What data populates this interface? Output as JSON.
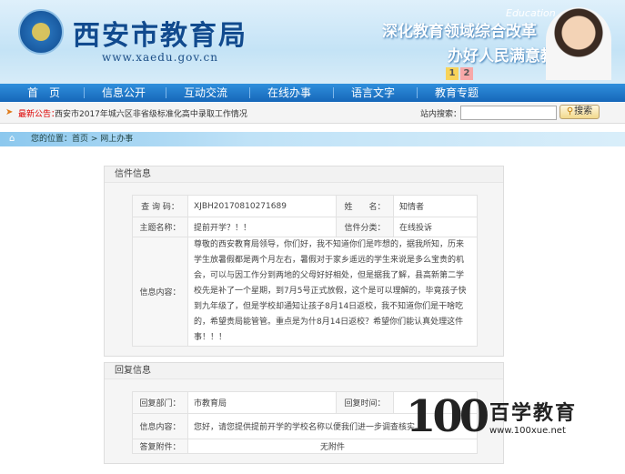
{
  "header": {
    "site_title": "西安市教育局",
    "site_url": "www.xaedu.gov.cn",
    "slogan_line1": "深化教育领域综合改革",
    "slogan_line2": "办好人民满意教育",
    "banner_word": "Education"
  },
  "nav": {
    "items": [
      "首　页",
      "信息公开",
      "互动交流",
      "在线办事",
      "语言文字",
      "教育专题"
    ]
  },
  "newsbar": {
    "label": "最新公告：",
    "text": "西安市2017年城六区非省级标准化高中录取工作情况",
    "search_label": "站内搜索：",
    "search_value": "",
    "search_button": "搜索"
  },
  "breadcrumb": {
    "text": "您的位置：首页 > 网上办事"
  },
  "letter": {
    "section_title": "信件信息",
    "query_label": "查 询 码：",
    "query_value": "XJBH20170810271689",
    "name_label": "姓　　名：",
    "name_value": "知情者",
    "subject_label": "主题名称：",
    "subject_value": "提前开学？！！",
    "category_label": "信件分类：",
    "category_value": "在线投诉",
    "content_label": "信息内容：",
    "content_value": "尊敬的西安教育局领导，你们好，我不知道你们是咋想的，据我所知，历来学生放暑假都是两个月左右，暑假对于家乡遥远的学生来说是多么宝贵的机会，可以与因工作分到两地的父母好好相处，但是据我了解，县高新第二学校先是补了一个星期，到7月5号正式放假，这个是可以理解的，毕竟孩子快到九年级了，但是学校却通知让孩子8月14日返校，我不知道你们是干啥吃的，希望贵局能管管。重点是为什8月14日返校？希望你们能认真处理这件事！！！"
  },
  "reply": {
    "section_title": "回复信息",
    "dept_label": "回复部门：",
    "dept_value": "市教育局",
    "time_label": "回复时间：",
    "time_value": "",
    "content_label": "信息内容：",
    "content_value": "您好，请您提供提前开学的学校名称以便我们进一步调查核实。",
    "attachment_label": "答复附件：",
    "attachment_value": "无附件"
  },
  "watermark": {
    "number": "100",
    "brand": "百学教育",
    "url": "www.100xue.net"
  },
  "colors": {
    "nav_blue": "#1667b9",
    "title_blue": "#114a8e",
    "notice_red": "#dd0000"
  }
}
